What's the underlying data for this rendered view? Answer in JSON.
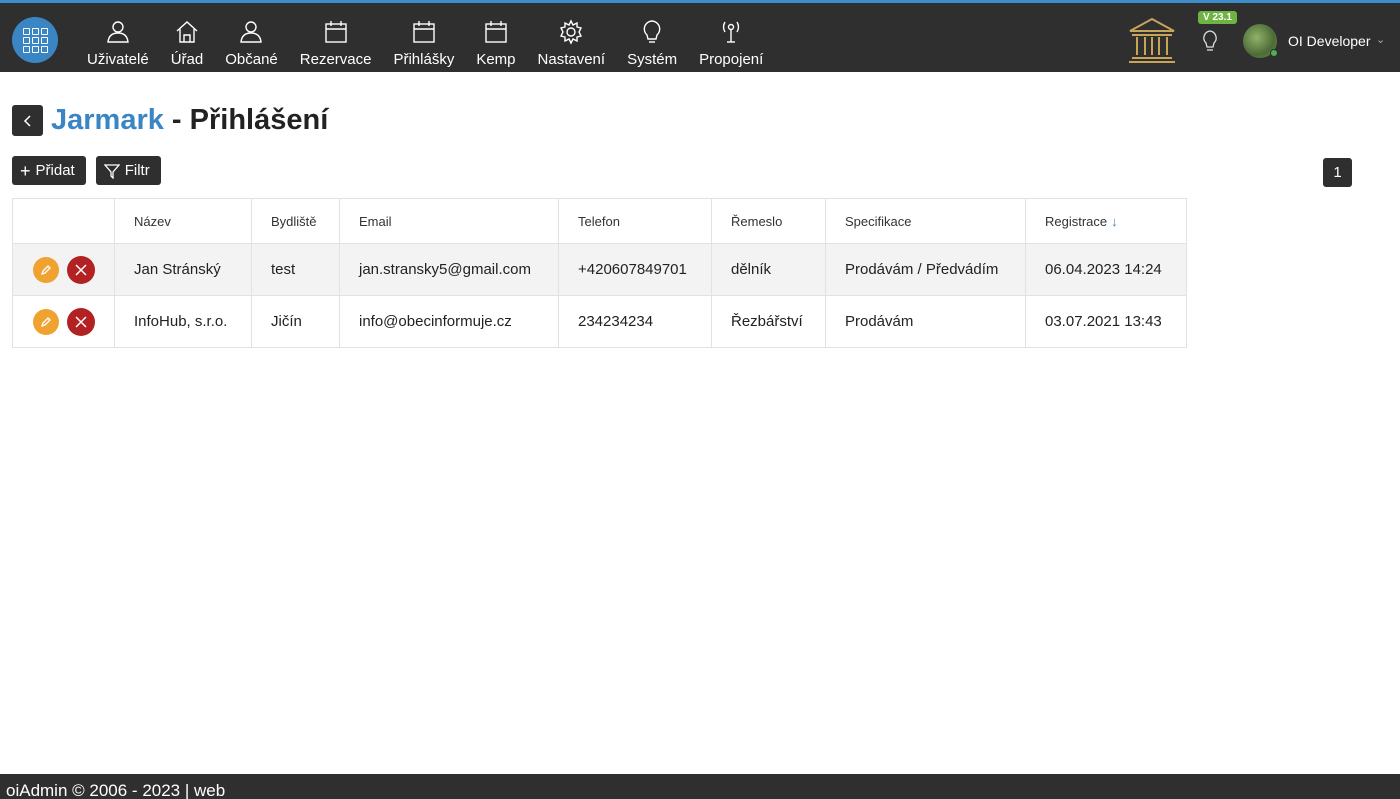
{
  "nav": {
    "items": [
      {
        "label": "Uživatelé",
        "icon": "user-icon"
      },
      {
        "label": "Úřad",
        "icon": "home-icon"
      },
      {
        "label": "Občané",
        "icon": "user-icon"
      },
      {
        "label": "Rezervace",
        "icon": "calendar-icon"
      },
      {
        "label": "Přihlášky",
        "icon": "calendar-icon"
      },
      {
        "label": "Kemp",
        "icon": "calendar-icon"
      },
      {
        "label": "Nastavení",
        "icon": "gear-icon"
      },
      {
        "label": "Systém",
        "icon": "lightbulb-icon"
      },
      {
        "label": "Propojení",
        "icon": "antenna-icon"
      }
    ]
  },
  "header": {
    "version": "V 23.1",
    "user_name": "OI Developer",
    "accent_color": "#3a86c4",
    "bar_color": "#2f2f2f"
  },
  "page": {
    "title_link": "Jarmark",
    "title_rest": " - Přihlášení"
  },
  "toolbar": {
    "add_label": "Přidat",
    "filter_label": "Filtr",
    "page_number": "1"
  },
  "table": {
    "headers": [
      "",
      "Název",
      "Bydliště",
      "Email",
      "Telefon",
      "Řemeslo",
      "Specifikace",
      "Registrace"
    ],
    "sort_indicator": "↓",
    "rows": [
      {
        "nazev": "Jan Stránský",
        "bydliste": "test",
        "email": "jan.stransky5@gmail.com",
        "telefon": "+420607849701",
        "remeslo": "dělník",
        "specifikace": "Prodávám / Předvádím",
        "registrace": "06.04.2023 14:24"
      },
      {
        "nazev": "InfoHub, s.r.o.",
        "bydliste": "Jičín",
        "email": "info@obecinformuje.cz",
        "telefon": "234234234",
        "remeslo": "Řezbářství",
        "specifikace": "Prodávám",
        "registrace": "03.07.2021 13:43"
      }
    ]
  },
  "footer": {
    "text": "oiAdmin © 2006 - 2023 | web"
  }
}
